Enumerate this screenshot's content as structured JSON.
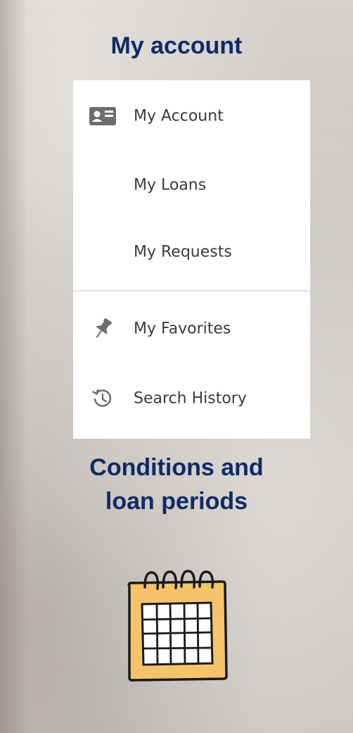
{
  "headings": {
    "my_account": "My account",
    "conditions": "Conditions and loan periods"
  },
  "menu": {
    "items": [
      {
        "label": "My Account",
        "icon": "id-card-icon"
      },
      {
        "label": "My Loans",
        "icon": ""
      },
      {
        "label": "My Requests",
        "icon": ""
      },
      {
        "label": "My Favorites",
        "icon": "pushpin-icon"
      },
      {
        "label": "Search History",
        "icon": "history-icon"
      }
    ]
  },
  "illustration": {
    "icon": "calendar-icon"
  },
  "colors": {
    "heading": "#0f2a66",
    "menu_text": "#3b3b3b",
    "calendar_fill": "#f5c46a"
  }
}
